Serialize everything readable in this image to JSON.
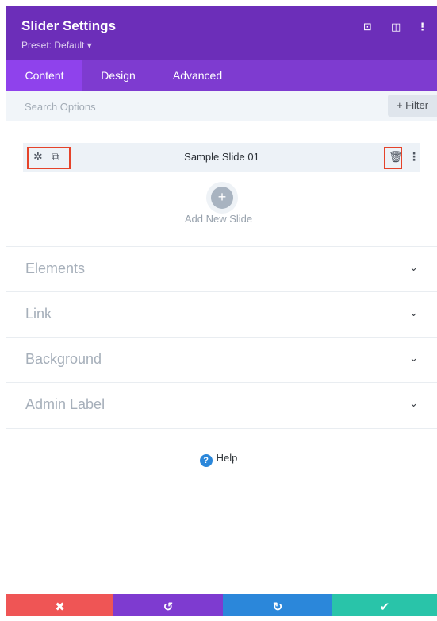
{
  "header": {
    "title": "Slider Settings",
    "preset": "Preset: Default ▾",
    "icons": [
      "focus-icon",
      "split-view-icon",
      "more-options-icon"
    ]
  },
  "tabs": [
    {
      "label": "Content",
      "active": true
    },
    {
      "label": "Design",
      "active": false
    },
    {
      "label": "Advanced",
      "active": false
    }
  ],
  "search": {
    "placeholder": "Search Options",
    "filter_label": "+ Filter"
  },
  "slide": {
    "title": "Sample Slide 01"
  },
  "add_slide": {
    "label": "Add New Slide"
  },
  "sections": [
    {
      "label": "Elements"
    },
    {
      "label": "Link"
    },
    {
      "label": "Background"
    },
    {
      "label": "Admin Label"
    }
  ],
  "help": {
    "label": "Help"
  },
  "footer": {
    "buttons": [
      {
        "name": "discard",
        "color": "#ef5555"
      },
      {
        "name": "undo",
        "color": "#7e3bd0"
      },
      {
        "name": "redo",
        "color": "#2b87da"
      },
      {
        "name": "save",
        "color": "#29c4a9"
      }
    ]
  },
  "colors": {
    "header_bg": "#6c2eb9",
    "tabs_bg": "#7e3bd0",
    "active_tab_bg": "#8f42ec",
    "highlight_outline": "#e5432a"
  }
}
